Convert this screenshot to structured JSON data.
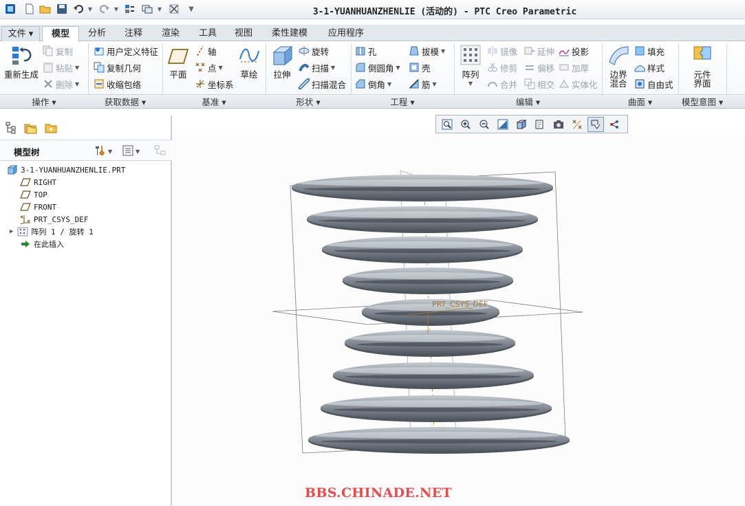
{
  "window": {
    "title": "3-1-YUANHUANZHENLIE (活动的) - PTC Creo Parametric"
  },
  "quick_access": {
    "icons": [
      "app-icon",
      "new-icon",
      "open-icon",
      "save-icon",
      "undo-icon",
      "redo-icon",
      "regenerate-icon",
      "window-switch-icon",
      "close-window-icon",
      "customize-icon"
    ]
  },
  "tabs": [
    {
      "label": "文件 ▾"
    },
    {
      "label": "模型"
    },
    {
      "label": "分析"
    },
    {
      "label": "注释"
    },
    {
      "label": "渲染"
    },
    {
      "label": "工具"
    },
    {
      "label": "视图"
    },
    {
      "label": "柔性建模"
    },
    {
      "label": "应用程序"
    }
  ],
  "ribbon": {
    "operations": {
      "regenerate": "重新生成",
      "copy": "复制",
      "paste": "粘贴",
      "delete": "删除"
    },
    "get_data": {
      "udf": "用户定义特征",
      "copy_geom": "复制几何",
      "shrinkwrap": "收缩包络"
    },
    "datum": {
      "plane": "平面",
      "axis": "轴",
      "point": "点",
      "csys": "坐标系",
      "sketch": "草绘"
    },
    "shapes": {
      "extrude": "拉伸",
      "revolve": "旋转",
      "sweep": "扫描",
      "swept_blend": "扫描混合"
    },
    "engineering": {
      "hole": "孔",
      "round": "倒圆角",
      "chamfer": "倒角",
      "draft": "拔模",
      "shell": "壳",
      "rib": "筋"
    },
    "editing": {
      "pattern": "阵列",
      "mirror": "镜像",
      "extend": "延伸",
      "project": "投影",
      "trim": "修剪",
      "offset": "偏移",
      "thicken": "加厚",
      "merge": "合并",
      "intersect": "相交",
      "solidify": "实体化"
    },
    "surfaces": {
      "boundary_blend_l1": "边界",
      "boundary_blend_l2": "混合",
      "fill": "填充",
      "style": "样式",
      "freestyle": "自由式"
    },
    "model_intent": {
      "component_interface_l1": "元件",
      "component_interface_l2": "界面"
    },
    "group_labels": {
      "operations": "操作 ▾",
      "get_data": "获取数据 ▾",
      "datum": "基准 ▾",
      "shapes": "形状 ▾",
      "engineering": "工程 ▾",
      "editing": "编辑 ▾",
      "surfaces": "曲面 ▾",
      "model_intent": "模型意图 ▾"
    }
  },
  "left_panel": {
    "header": "模型树",
    "tree": [
      {
        "label": "3-1-YUANHUANZHENLIE.PRT",
        "icon": "part-icon"
      },
      {
        "label": "RIGHT",
        "icon": "datum-plane-icon"
      },
      {
        "label": "TOP",
        "icon": "datum-plane-icon"
      },
      {
        "label": "FRONT",
        "icon": "datum-plane-icon"
      },
      {
        "label": "PRT_CSYS_DEF",
        "icon": "csys-icon"
      },
      {
        "label": "阵列 1 / 旋转 1",
        "icon": "pattern-icon"
      },
      {
        "label": "在此插入",
        "icon": "insert-here-icon"
      }
    ]
  },
  "viewport": {
    "csys_label": "PRT_CSYS_DEF",
    "coil_color": "#7d8590",
    "ring_count": 9
  },
  "watermark": "BBS.CHINADE.NET",
  "colors": {
    "accent": "#1e6fc8",
    "ribbon_bg": "#f4f6f8",
    "tab_bg": "#e3e8ee"
  }
}
